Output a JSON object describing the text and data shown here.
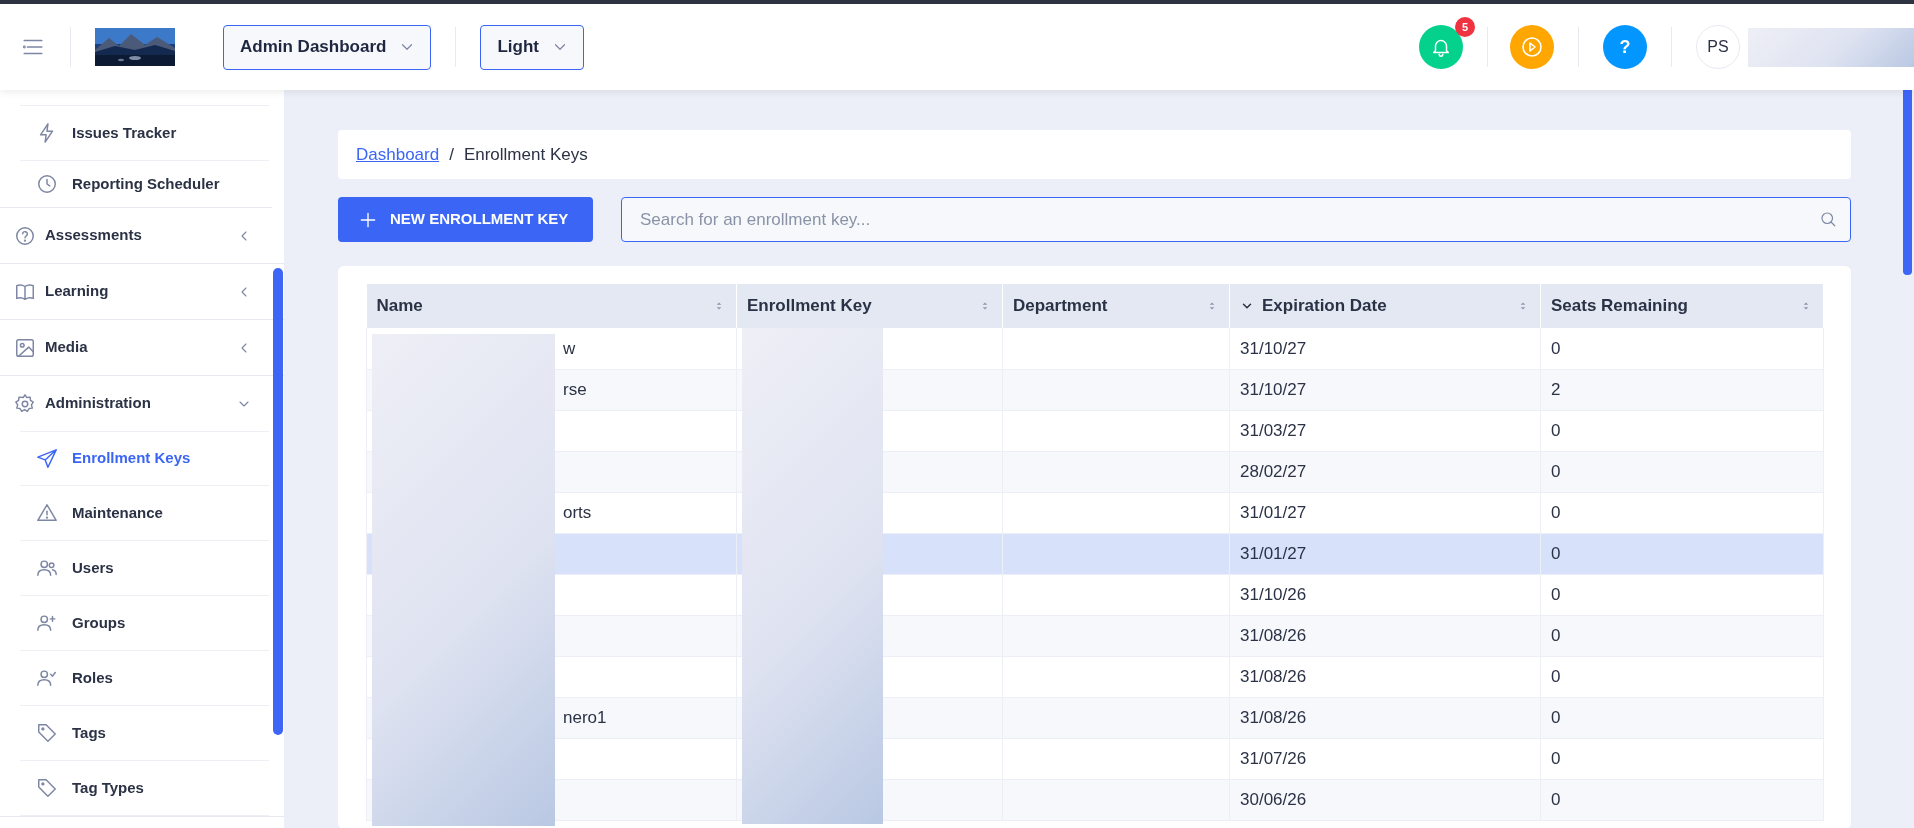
{
  "topbar": {
    "dropdowns": [
      {
        "label": "Admin Dashboard"
      },
      {
        "label": "Light"
      }
    ],
    "notifications": {
      "count": "5"
    },
    "help": {
      "label": "?"
    },
    "avatar": {
      "initials": "PS"
    }
  },
  "sidebar": {
    "continued_items": [
      {
        "label": "Issues Tracker",
        "selected": false
      },
      {
        "label": "Reporting Scheduler",
        "selected": false
      }
    ],
    "items": [
      {
        "label": "Assessments",
        "selected": false,
        "expanded": false
      },
      {
        "label": "Learning",
        "selected": false,
        "expanded": false
      },
      {
        "label": "Media",
        "selected": false,
        "expanded": false
      },
      {
        "label": "Administration",
        "selected": false,
        "expanded": true,
        "children": [
          {
            "label": "Enrollment Keys",
            "selected": true
          },
          {
            "label": "Maintenance",
            "selected": false
          },
          {
            "label": "Users",
            "selected": false
          },
          {
            "label": "Groups",
            "selected": false
          },
          {
            "label": "Roles",
            "selected": false
          },
          {
            "label": "Tags",
            "selected": false
          },
          {
            "label": "Tag Types",
            "selected": false
          }
        ]
      }
    ]
  },
  "breadcrumb": [
    {
      "label": "Dashboard",
      "link": true
    },
    {
      "separator": "/",
      "label": "Enrollment Keys",
      "link": false
    }
  ],
  "new_button": {
    "label": "NEW ENROLLMENT KEY"
  },
  "search": {
    "placeholder": "Search for an enrollment key..."
  },
  "table": {
    "columns": [
      {
        "label": "Name",
        "sorted": false
      },
      {
        "label": "Enrollment Key",
        "sorted": false
      },
      {
        "label": "Department",
        "sorted": false
      },
      {
        "label": "Expiration Date",
        "sorted": true
      },
      {
        "label": "Seats Remaining",
        "sorted": false
      }
    ],
    "rows": [
      {
        "name": "w",
        "expiration": "31/10/27",
        "seats": "0",
        "selected": false
      },
      {
        "name": "rse",
        "expiration": "31/10/27",
        "seats": "2",
        "selected": false
      },
      {
        "expiration": "31/03/27",
        "seats": "0",
        "selected": false
      },
      {
        "expiration": "28/02/27",
        "seats": "0",
        "selected": false
      },
      {
        "name": "orts",
        "expiration": "31/01/27",
        "seats": "0",
        "selected": false
      },
      {
        "expiration": "31/01/27",
        "seats": "0",
        "selected": true
      },
      {
        "expiration": "31/10/26",
        "seats": "0",
        "selected": false
      },
      {
        "expiration": "31/08/26",
        "seats": "0",
        "selected": false
      },
      {
        "expiration": "31/08/26",
        "seats": "0",
        "selected": false
      },
      {
        "name": "nero1",
        "expiration": "31/08/26",
        "seats": "0",
        "selected": false
      },
      {
        "expiration": "31/07/26",
        "seats": "0",
        "selected": false
      },
      {
        "expiration": "30/06/26",
        "seats": "0",
        "selected": false
      }
    ]
  }
}
